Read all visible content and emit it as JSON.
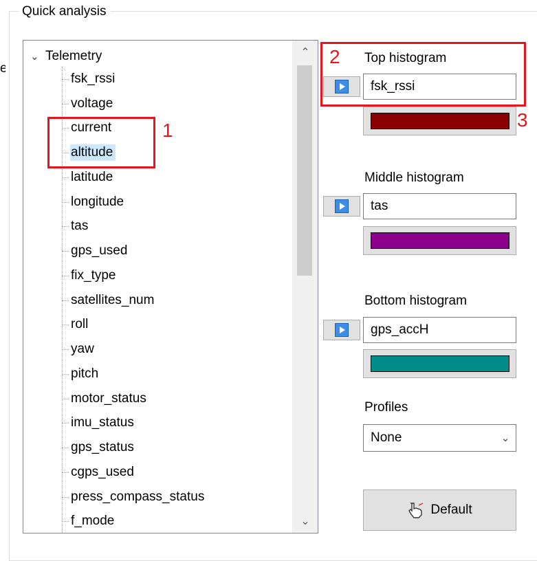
{
  "group": {
    "title": "Quick analysis",
    "clipped_text": "e"
  },
  "tree": {
    "root_label": "Telemetry",
    "items": [
      "fsk_rssi",
      "voltage",
      "current",
      "altitude",
      "latitude",
      "longitude",
      "tas",
      "gps_used",
      "fix_type",
      "satellites_num",
      "roll",
      "yaw",
      "pitch",
      "motor_status",
      "imu_status",
      "gps_status",
      "cgps_used",
      "press_compass_status",
      "f_mode"
    ],
    "selected": "altitude"
  },
  "histograms": {
    "top": {
      "label": "Top histogram",
      "value": "fsk_rssi",
      "color": "#8b0000"
    },
    "middle": {
      "label": "Middle histogram",
      "value": "tas",
      "color": "#8b008b"
    },
    "bottom": {
      "label": "Bottom histogram",
      "value": "gps_accH",
      "color": "#008b8b"
    }
  },
  "profiles": {
    "label": "Profiles",
    "selected": "None"
  },
  "default_button": {
    "label": "Default",
    "icon": "hand-pointer-icon"
  },
  "annotations": {
    "one": "1",
    "two": "2",
    "three": "3",
    "color": "#e8141c"
  }
}
